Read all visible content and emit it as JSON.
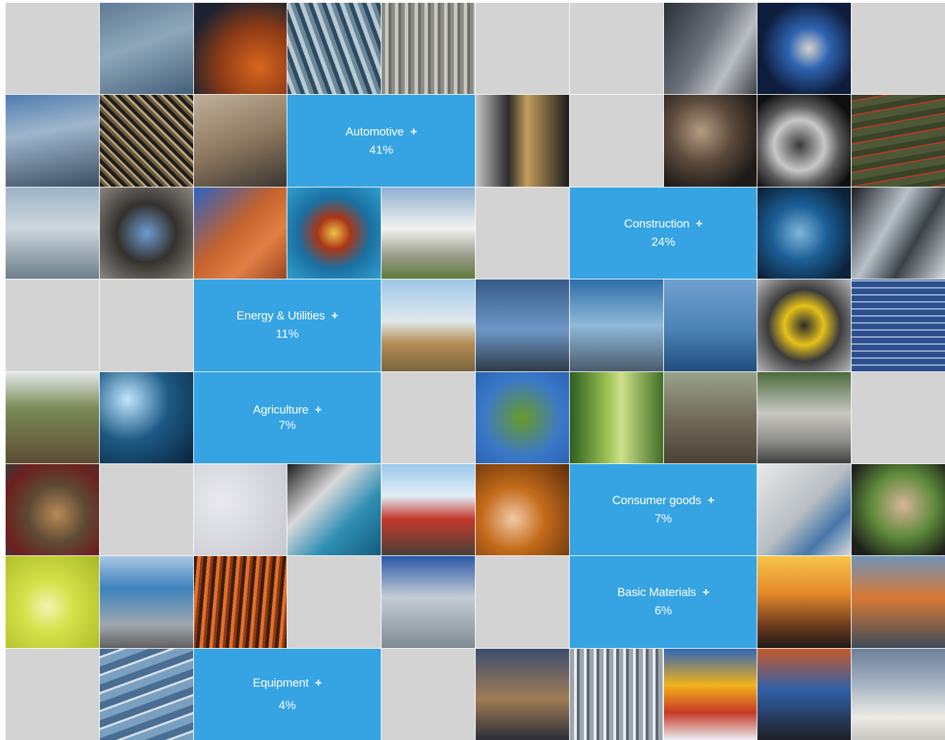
{
  "sectors": {
    "automotive": {
      "label": "Automotive",
      "icon": "+",
      "share": "41%"
    },
    "construction": {
      "label": "Construction",
      "icon": "+",
      "share": "24%"
    },
    "energy": {
      "label": "Energy & Utilities",
      "icon": "+",
      "share": "11%"
    },
    "agriculture": {
      "label": "Agriculture",
      "icon": "+",
      "share": "7%"
    },
    "consumer": {
      "label": "Consumer goods",
      "icon": "+",
      "share": "7%"
    },
    "basic": {
      "label": "Basic Materials",
      "icon": "+",
      "share": "6%"
    },
    "equipment": {
      "label": "Equipment",
      "icon": "+",
      "share": "4%"
    }
  },
  "colors": {
    "tile_accent": "#36a3e2",
    "tile_blank": "#d3d3d3",
    "text_on_accent": "#ffffff"
  }
}
